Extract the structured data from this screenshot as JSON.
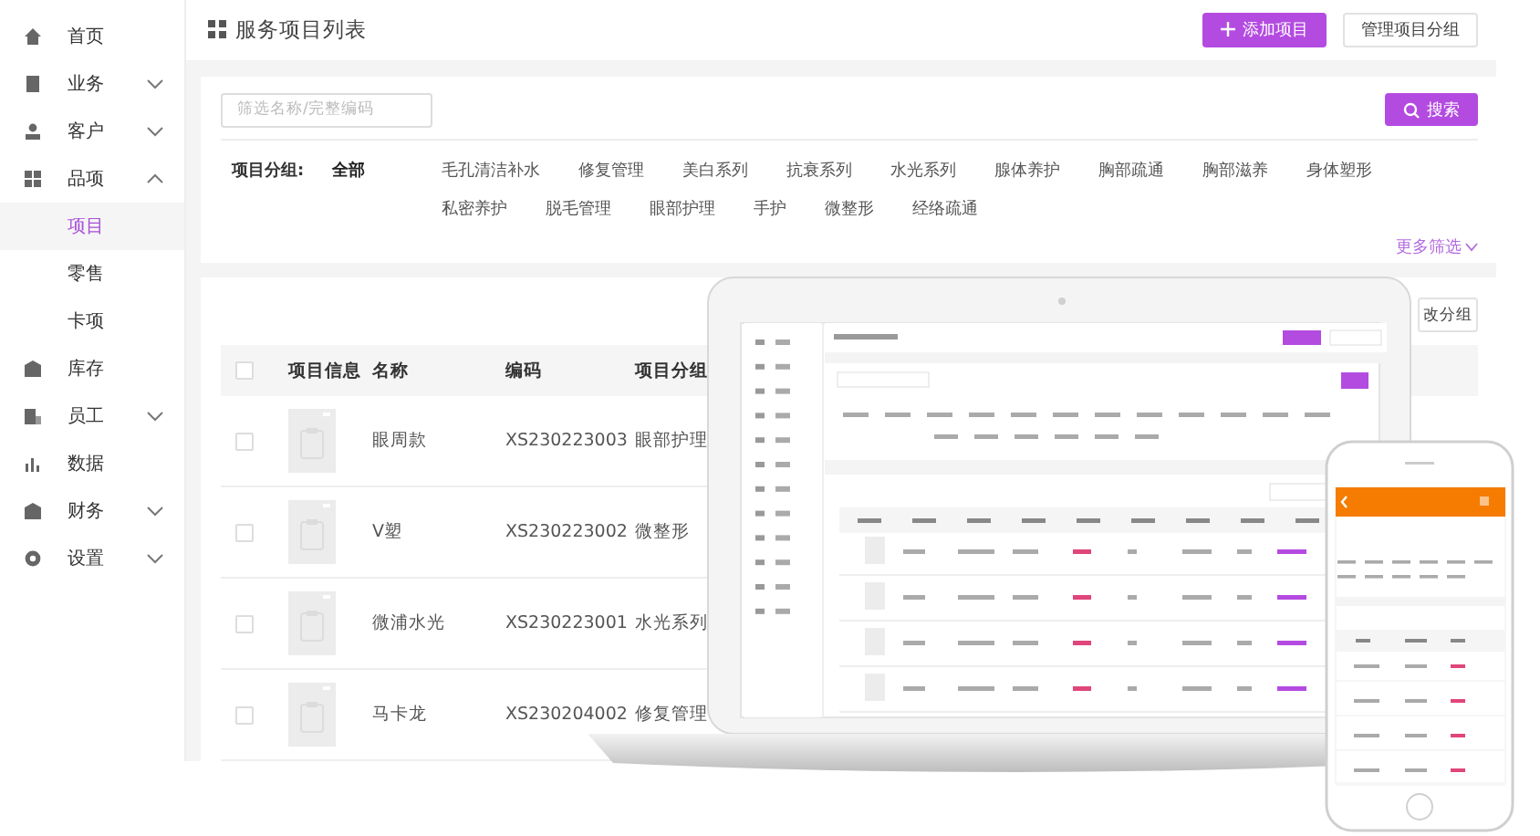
{
  "sidebar": {
    "items": [
      {
        "label": "首页",
        "selected": false
      },
      {
        "label": "业务",
        "selected": false,
        "expanded": false
      },
      {
        "label": "客户",
        "selected": false,
        "expanded": false
      },
      {
        "label": "品项",
        "selected": false,
        "expanded": true,
        "children": [
          {
            "label": "项目",
            "selected": true
          },
          {
            "label": "零售",
            "selected": false
          },
          {
            "label": "卡项",
            "selected": false
          }
        ]
      },
      {
        "label": "库存",
        "selected": false
      },
      {
        "label": "员工",
        "selected": false,
        "expanded": false
      },
      {
        "label": "数据",
        "selected": false
      },
      {
        "label": "财务",
        "selected": false,
        "expanded": false
      },
      {
        "label": "设置",
        "selected": false,
        "expanded": false
      }
    ]
  },
  "header": {
    "title": "服务项目列表",
    "buttons": [
      {
        "label": "添加项目",
        "kind": "primary"
      },
      {
        "label": "管理项目分组",
        "kind": "default"
      }
    ]
  },
  "filter": {
    "search": {
      "placeholder": "筛选名称/完整编码"
    },
    "search_button": "搜索",
    "group_label": "项目分组:",
    "groups": [
      {
        "label": "全部",
        "selected": true
      },
      {
        "label": "毛孔清洁补水",
        "selected": false
      },
      {
        "label": "修复管理",
        "selected": false
      },
      {
        "label": "美白系列",
        "selected": false
      },
      {
        "label": "抗衰系列",
        "selected": false
      },
      {
        "label": "水光系列",
        "selected": false
      },
      {
        "label": "腺体养护",
        "selected": false
      },
      {
        "label": "胸部疏通",
        "selected": false
      },
      {
        "label": "胸部滋养",
        "selected": false
      },
      {
        "label": "身体塑形",
        "selected": false
      },
      {
        "label": "私密养护",
        "selected": false
      },
      {
        "label": "脱毛管理",
        "selected": false
      },
      {
        "label": "眼部护理",
        "selected": false
      },
      {
        "label": "手护",
        "selected": false
      },
      {
        "label": "微整形",
        "selected": false
      },
      {
        "label": "经络疏通",
        "selected": false
      }
    ],
    "more": "更多筛选"
  },
  "table": {
    "partial_button": "改分组",
    "columns": [
      "项目信息",
      "名称",
      "编码",
      "项目分组"
    ],
    "header_checked": false,
    "rows": [
      {
        "checked": false,
        "name": "眼周款",
        "code": "XS230223003",
        "group": "眼部护理"
      },
      {
        "checked": false,
        "name": "V塑",
        "code": "XS230223002",
        "group": "微整形"
      },
      {
        "checked": false,
        "name": "微浦水光",
        "code": "XS230223001",
        "group": "水光系列"
      },
      {
        "checked": false,
        "name": "马卡龙",
        "code": "XS230204002",
        "group": "修复管理"
      }
    ]
  }
}
